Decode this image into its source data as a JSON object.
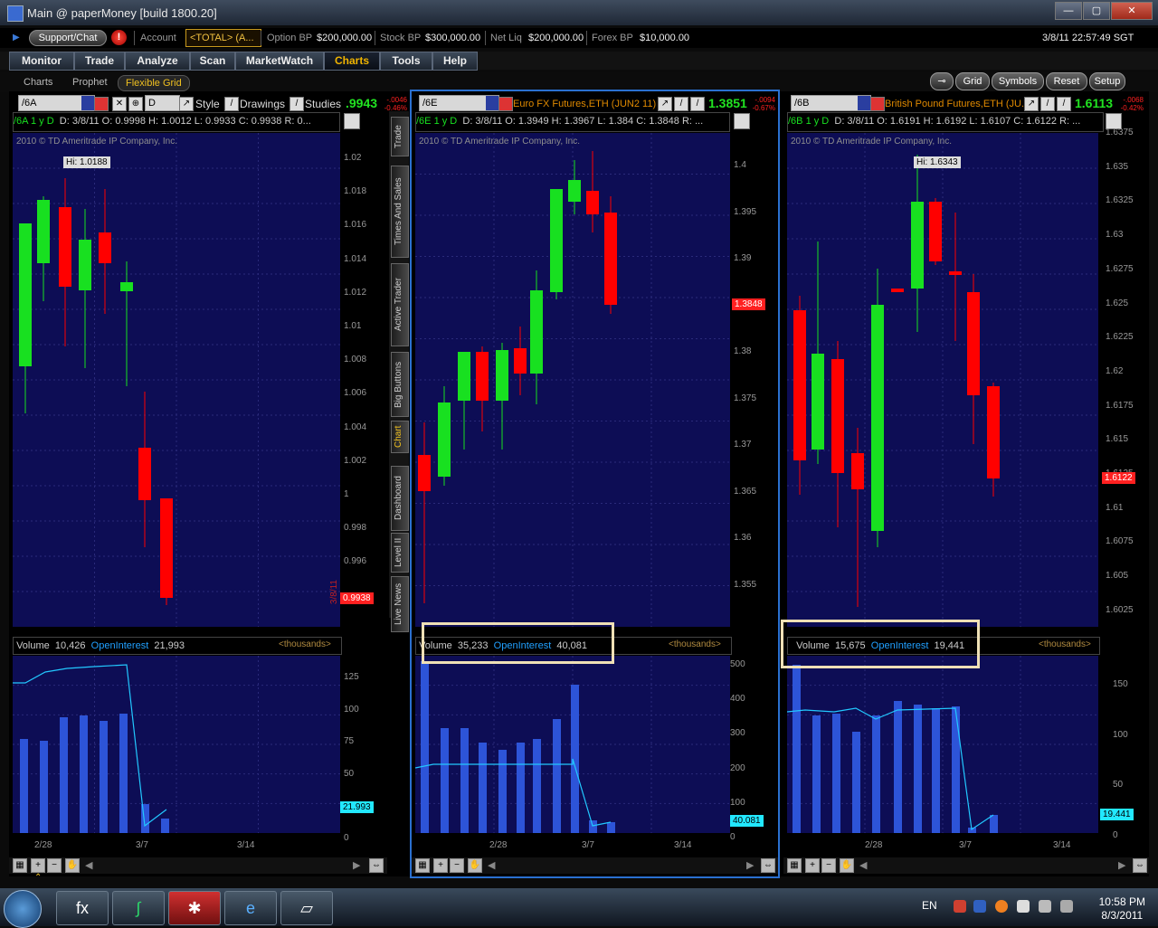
{
  "window": {
    "title": "Main @ paperMoney [build 1800.20]"
  },
  "topbar": {
    "support": "Support/Chat",
    "alert": "!",
    "account_label": "Account",
    "account_value": "<TOTAL> (A...",
    "option_bp_label": "Option BP",
    "option_bp": "$200,000.00",
    "stock_bp_label": "Stock BP",
    "stock_bp": "$300,000.00",
    "net_liq_label": "Net Liq",
    "net_liq": "$200,000.00",
    "forex_bp_label": "Forex BP",
    "forex_bp": "$10,000.00",
    "datetime": "3/8/11 22:57:49 SGT"
  },
  "tabs": [
    "Monitor",
    "Trade",
    "Analyze",
    "Scan",
    "MarketWatch",
    "Charts",
    "Tools",
    "Help"
  ],
  "active_tab": "Charts",
  "subtabs": [
    "Charts",
    "Prophet",
    "Flexible Grid"
  ],
  "right_buttons": {
    "grid": "Grid",
    "symbols": "Symbols",
    "reset": "Reset",
    "setup": "Setup"
  },
  "sidebar": [
    "Trade",
    "Times And Sales",
    "Active Trader",
    "Big Buttons",
    "Chart",
    "Dashboard",
    "Level II",
    "Live News"
  ],
  "pane1": {
    "symbol": "/6A",
    "period": "D",
    "style": "Style",
    "drawings": "Drawings",
    "studies": "Studies",
    "price": ".9943",
    "chg1": "-.0046",
    "chg2": "-0.46%",
    "ohlc_sym": "/6A 1 y D",
    "ohlc": "D: 3/8/11   O: 0.9998   H: 1.0012   L: 0.9933   C: 0.9938   R: 0...",
    "copyright": "2010 © TD Ameritrade IP Company, Inc.",
    "hi": "Hi: 1.0188",
    "last": "0.9938",
    "date_tag": "3/8/11",
    "yaxis": [
      "1.02",
      "1.018",
      "1.016",
      "1.014",
      "1.012",
      "1.01",
      "1.008",
      "1.006",
      "1.004",
      "1.002",
      "1",
      "0.998",
      "0.996"
    ],
    "vol_label": "Volume",
    "vol": "10,426",
    "oi_label": "OpenInterest",
    "oi": "21,993",
    "thousands": "<thousands>",
    "vaxis": [
      "125",
      "100",
      "75",
      "50",
      "25",
      "0"
    ],
    "oi_tag": "21.993",
    "xaxis": [
      "2/28",
      "3/7",
      "3/14"
    ]
  },
  "pane2": {
    "symbol": "/6E",
    "desc": "Euro FX Futures,ETH (JUN2 11)",
    "price": "1.3851",
    "chg1": "-.0094",
    "chg2": "-0.67%",
    "ohlc_sym": "/6E 1 y D",
    "ohlc": "D: 3/8/11   O: 1.3949   H: 1.3967   L: 1.384   C: 1.3848   R: ...",
    "copyright": "2010 © TD Ameritrade IP Company, Inc.",
    "last": "1.3848",
    "yaxis": [
      "1.4",
      "1.395",
      "1.39",
      "1.385",
      "1.38",
      "1.375",
      "1.37",
      "1.365",
      "1.36",
      "1.355"
    ],
    "vol_label": "Volume",
    "vol": "35,233",
    "oi_label": "OpenInterest",
    "oi": "40,081",
    "thousands": "<thousands>",
    "vaxis": [
      "500",
      "400",
      "300",
      "200",
      "100",
      "0"
    ],
    "oi_tag": "40.081",
    "xaxis": [
      "2/28",
      "3/7",
      "3/14"
    ]
  },
  "pane3": {
    "symbol": "/6B",
    "desc": "British Pound Futures,ETH (JU...",
    "price": "1.6113",
    "chg1": "-.0068",
    "chg2": "-0.42%",
    "ohlc_sym": "/6B 1 y D",
    "ohlc": "D: 3/8/11   O: 1.6191   H: 1.6192   L: 1.6107   C: 1.6122   R: ...",
    "copyright": "2010 © TD Ameritrade IP Company, Inc.",
    "hi": "Hi: 1.6343",
    "last": "1.6122",
    "yaxis": [
      "1.6375",
      "1.635",
      "1.6325",
      "1.63",
      "1.6275",
      "1.625",
      "1.6225",
      "1.62",
      "1.6175",
      "1.615",
      "1.6125",
      "1.61",
      "1.6075",
      "1.605",
      "1.6025"
    ],
    "vol_label": "Volume",
    "vol": "15,675",
    "oi_label": "OpenInterest",
    "oi": "19,441",
    "thousands": "<thousands>",
    "vaxis": [
      "150",
      "100",
      "50",
      "0"
    ],
    "oi_tag": "19.441",
    "xaxis": [
      "2/28",
      "3/7",
      "3/14"
    ]
  },
  "taskbar": {
    "lang": "EN",
    "time": "10:58 PM",
    "date": "8/3/2011",
    "fx": "fx"
  },
  "colors": {
    "up": "#18e020",
    "down": "#ff0000",
    "plot": "#0d0d55",
    "vol": "#2d54d8",
    "oi": "#22c8ff",
    "accent": "#f0b400"
  }
}
